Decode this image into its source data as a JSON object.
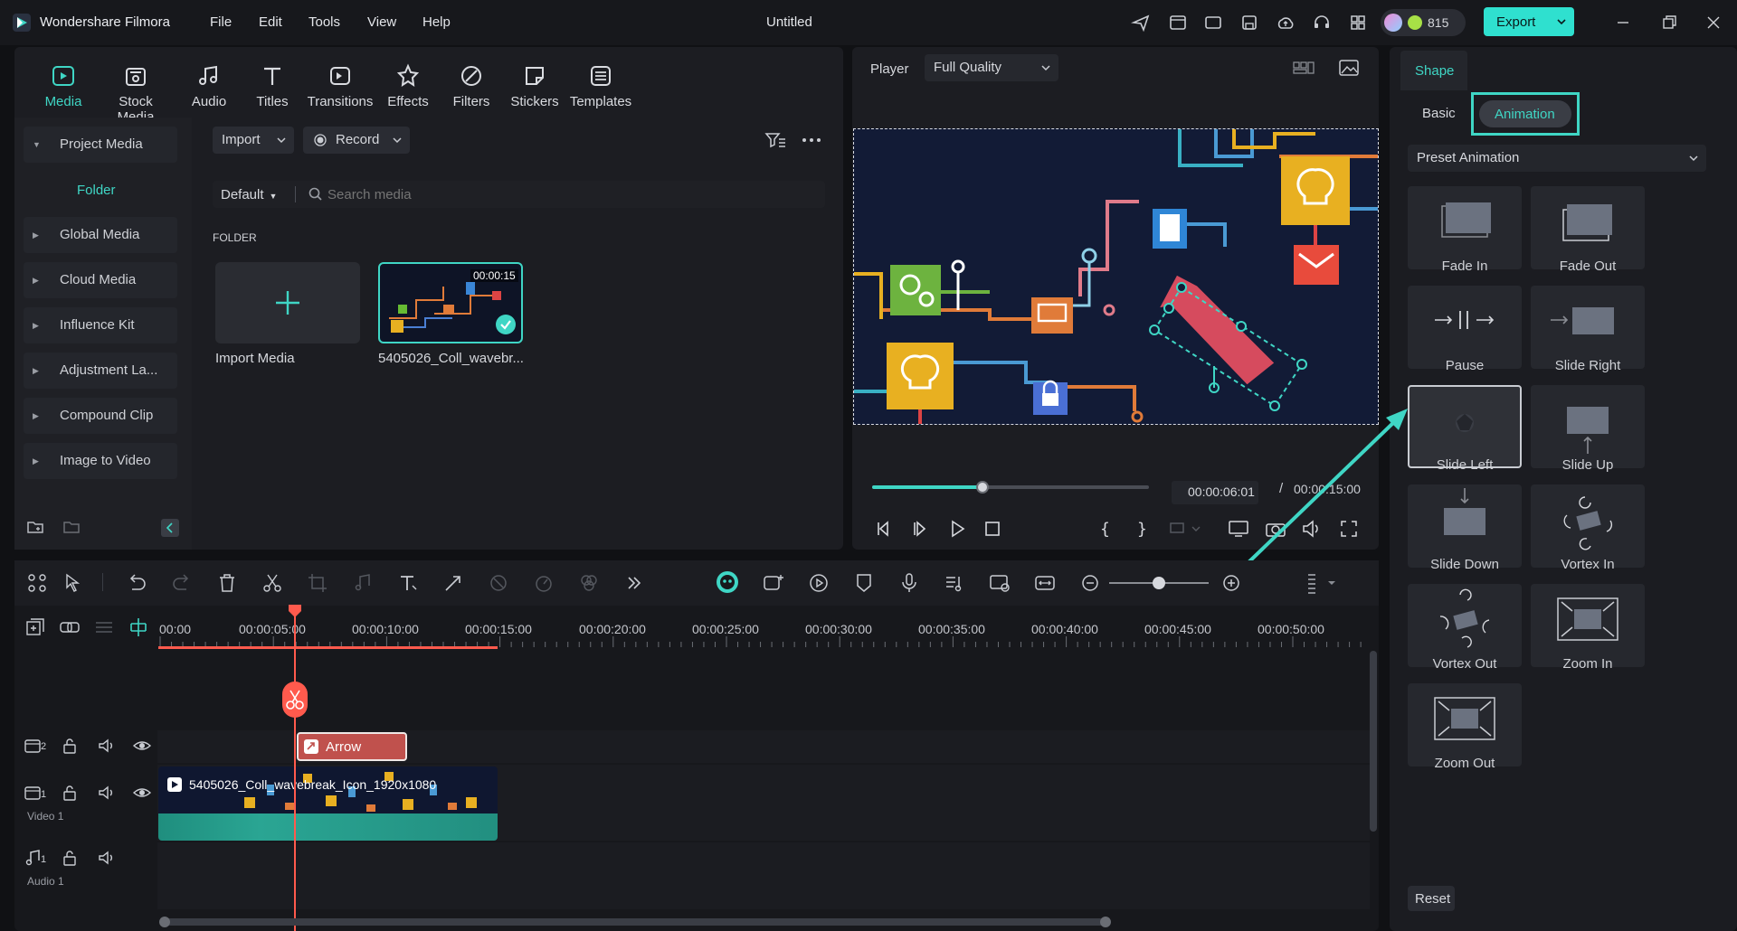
{
  "app": {
    "name": "Wondershare Filmora",
    "title": "Untitled",
    "credits": "815",
    "export_label": "Export"
  },
  "menu": [
    "File",
    "Edit",
    "Tools",
    "View",
    "Help"
  ],
  "toolbar": [
    {
      "label": "Media",
      "icon": "media-icon"
    },
    {
      "label": "Stock Media",
      "icon": "stock-media-icon"
    },
    {
      "label": "Audio",
      "icon": "audio-icon"
    },
    {
      "label": "Titles",
      "icon": "titles-icon"
    },
    {
      "label": "Transitions",
      "icon": "transitions-icon"
    },
    {
      "label": "Effects",
      "icon": "effects-icon"
    },
    {
      "label": "Filters",
      "icon": "filters-icon"
    },
    {
      "label": "Stickers",
      "icon": "stickers-icon"
    },
    {
      "label": "Templates",
      "icon": "templates-icon"
    }
  ],
  "sidebar": {
    "project_media": "Project Media",
    "folder": "Folder",
    "items": [
      "Global Media",
      "Cloud Media",
      "Influence Kit",
      "Adjustment La...",
      "Compound Clip",
      "Image to Video"
    ]
  },
  "media": {
    "import_label": "Import",
    "record_label": "Record",
    "sort_label": "Default",
    "search_placeholder": "Search media",
    "folder_header": "FOLDER",
    "import_media_label": "Import Media",
    "clip_name": "5405026_Coll_wavebr...",
    "clip_duration": "00:00:15"
  },
  "player": {
    "label": "Player",
    "quality": "Full Quality",
    "current_time": "00:00:06:01",
    "separator": "/",
    "total_time": "00:00:15:00",
    "progress": 0.4
  },
  "right_panel": {
    "tab_shape": "Shape",
    "tab_basic": "Basic",
    "tab_animation": "Animation",
    "preset": "Preset Animation",
    "reset": "Reset",
    "animations": [
      "Fade In",
      "Fade Out",
      "Pause",
      "Slide Right",
      "Slide Left",
      "Slide Up",
      "Slide Down",
      "Vortex In",
      "Vortex Out",
      "Zoom In",
      "Zoom Out"
    ],
    "selected": "Slide Left"
  },
  "timeline": {
    "ruler": [
      "00:00",
      "00:00:05:00",
      "00:00:10:00",
      "00:00:15:00",
      "00:00:20:00",
      "00:00:25:00",
      "00:00:30:00",
      "00:00:35:00",
      "00:00:40:00",
      "00:00:45:00",
      "00:00:50:00"
    ],
    "arrow_clip": "Arrow",
    "video_clip": "5405026_Coll_wavebreak_Icon_1920x1080",
    "track2_num": "2",
    "track1_num": "1",
    "video_track_label": "Video 1",
    "audio_num": "1",
    "audio_track_label": "Audio 1"
  },
  "colors": {
    "accent": "#3fd6c5",
    "playhead": "#ff5a4d",
    "export_bg": "#2fe0cf"
  }
}
